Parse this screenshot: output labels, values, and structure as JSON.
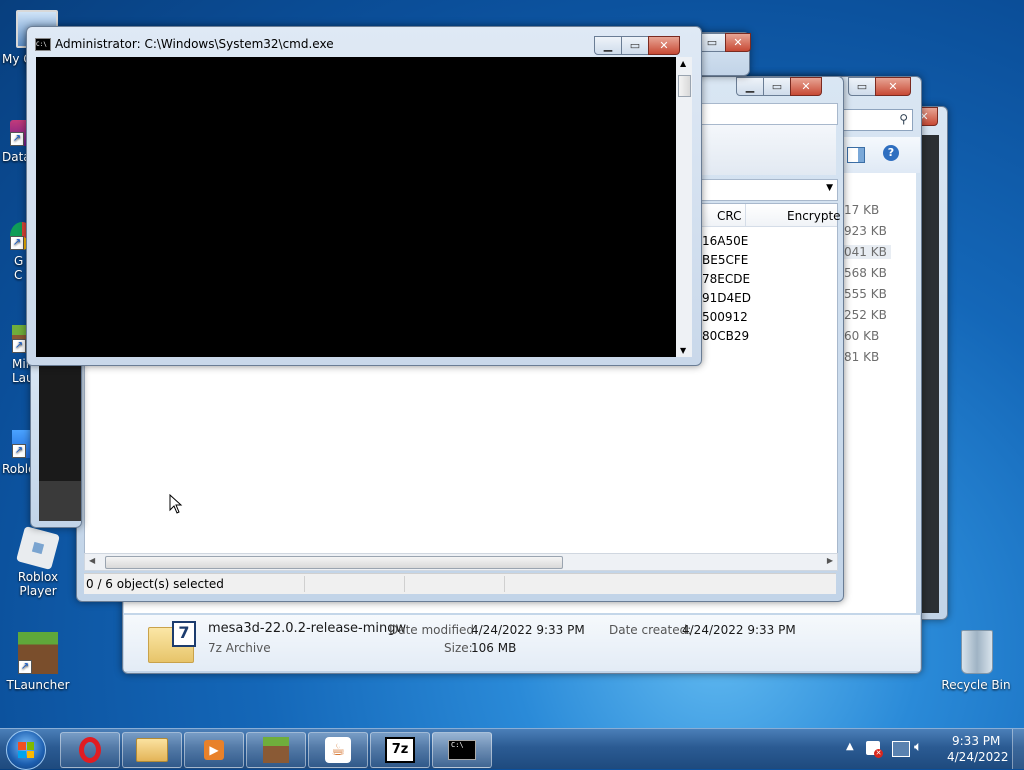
{
  "desktop": {
    "icons": [
      {
        "label": "My C"
      },
      {
        "label": "Data"
      },
      {
        "label": "G\nC"
      },
      {
        "label": "Min\nLau"
      },
      {
        "label": "Roblo"
      },
      {
        "label": "Roblox Player"
      },
      {
        "label": "TLauncher"
      },
      {
        "label": "Recycle Bin"
      }
    ]
  },
  "cmd": {
    "title": "Administrator: C:\\Windows\\System32\\cmd.exe",
    "icon_text": "C:\\"
  },
  "sevenzip": {
    "columns": [
      "CRC",
      "Encrypte"
    ],
    "crc_values": [
      "16A50E",
      "BE5CFE",
      "78ECDE",
      "91D4ED",
      "500912",
      "80CB29"
    ],
    "status": "0 / 6 object(s) selected"
  },
  "explorer": {
    "sizes": [
      "17 KB",
      "923 KB",
      "041 KB",
      "568 KB",
      "555 KB",
      "252 KB",
      "60 KB",
      "81 KB"
    ],
    "details": {
      "filename": "mesa3d-22.0.2-release-mingw",
      "type": "7z Archive",
      "date_modified_label": "Date modified:",
      "date_modified": "4/24/2022 9:33 PM",
      "date_created_label": "Date created:",
      "date_created": "4/24/2022 9:33 PM",
      "size_label": "Size:",
      "size": "106 MB",
      "icon_text": "7"
    }
  },
  "taskbar": {
    "sevenzip_text": "7z",
    "clock_time": "9:33 PM",
    "clock_date": "4/24/2022"
  },
  "colors": {
    "cmd_bg": "#000000",
    "accent": "#1e4a7e"
  }
}
